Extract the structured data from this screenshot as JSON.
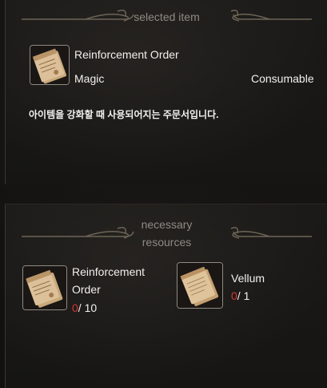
{
  "selected": {
    "section_title": "selected item",
    "item_name": "Reinforcement Order",
    "grade": "Magic",
    "category": "Consumable",
    "description": "아이템을 강화할 때 사용되어지는 주문서입니다.",
    "icon": "scroll-icon"
  },
  "resources": {
    "section_title_line1": "necessary",
    "section_title_line2": "resources",
    "items": [
      {
        "name_line1": "Reinforcement",
        "name_line2": "Order",
        "have": "0",
        "separator": "/",
        "need": "10",
        "icon": "scroll-icon"
      },
      {
        "name_line1": "Vellum",
        "name_line2": "",
        "have": "0",
        "separator": "/",
        "need": "1",
        "icon": "vellum-icon"
      }
    ]
  },
  "colors": {
    "count_have": "#d23a32",
    "text": "#f2f0ec",
    "section_title": "#8e8a84",
    "ornament": "#7a6f60"
  }
}
